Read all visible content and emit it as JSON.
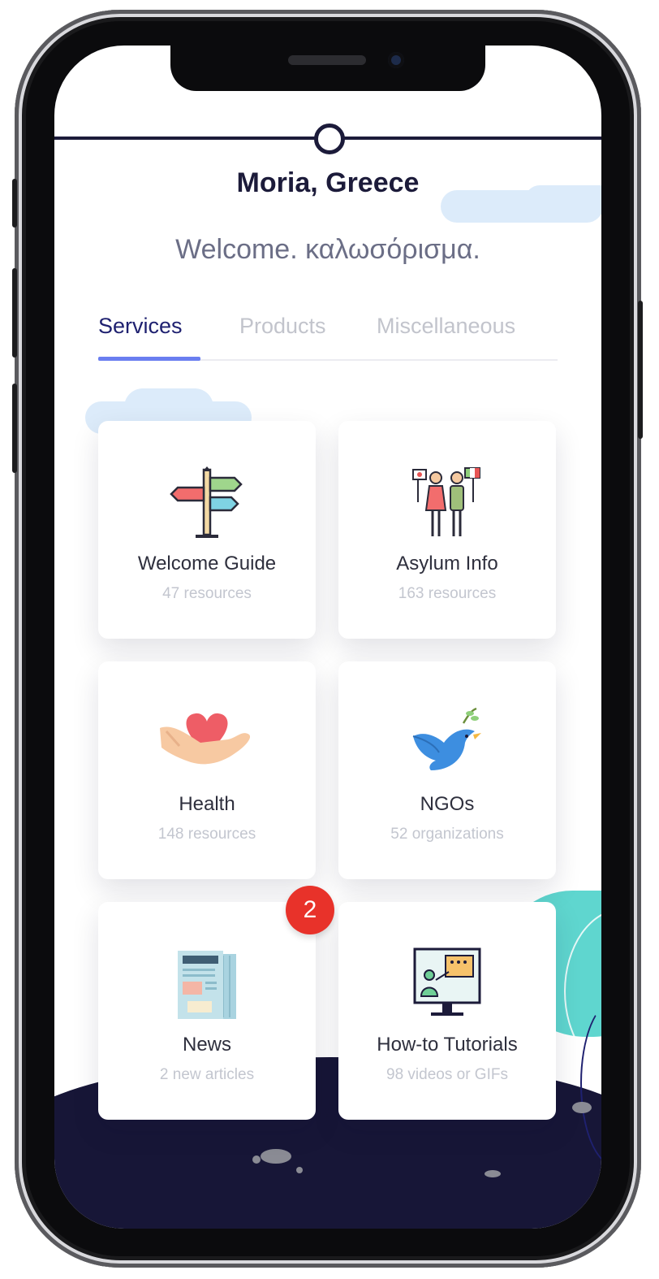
{
  "header": {
    "location": "Moria, Greece",
    "welcome": "Welcome. καλωσόρισμα."
  },
  "tabs": [
    {
      "label": "Services",
      "active": true
    },
    {
      "label": "Products",
      "active": false
    },
    {
      "label": "Miscellaneous",
      "active": false
    }
  ],
  "cards": [
    {
      "title": "Welcome Guide",
      "subtitle": "47 resources",
      "icon": "signpost-icon"
    },
    {
      "title": "Asylum Info",
      "subtitle": "163 resources",
      "icon": "people-flags-icon"
    },
    {
      "title": "Health",
      "subtitle": "148 resources",
      "icon": "heart-hand-icon"
    },
    {
      "title": "NGOs",
      "subtitle": "52 organizations",
      "icon": "dove-icon"
    },
    {
      "title": "News",
      "subtitle": "2 new articles",
      "icon": "newspaper-icon",
      "badge": "2"
    },
    {
      "title": "How-to Tutorials",
      "subtitle": "98 videos or GIFs",
      "icon": "monitor-tutorial-icon"
    }
  ],
  "colors": {
    "primary": "#1c1b3a",
    "accent": "#6a7ef0",
    "badge": "#e8322a",
    "muted": "#c3c6cf"
  }
}
